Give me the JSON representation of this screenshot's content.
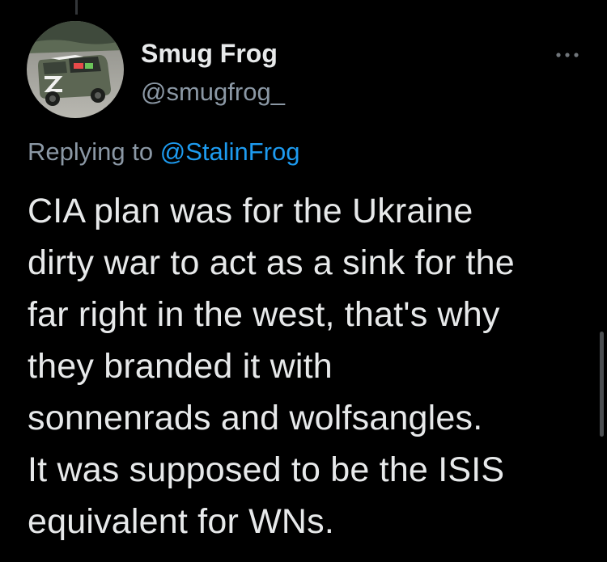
{
  "author": {
    "display_name": "Smug Frog",
    "handle": "@smugfrog_"
  },
  "reply_context": {
    "prefix": "Replying to",
    "mention": "@StalinFrog"
  },
  "tweet": {
    "lines": [
      "CIA plan was for the Ukraine",
      "dirty war to act as a sink for the",
      "far right in the west, that's why",
      "they branded it with",
      "sonnenrads and wolfsangles.",
      "It was supposed to be the ISIS",
      "equivalent for WNs."
    ]
  },
  "icons": {
    "more": "more-options-icon",
    "avatar": "user-avatar"
  },
  "colors": {
    "background": "#000000",
    "text_primary": "#e7e9ea",
    "text_secondary": "#8b98a5",
    "accent": "#1d9bf0"
  }
}
